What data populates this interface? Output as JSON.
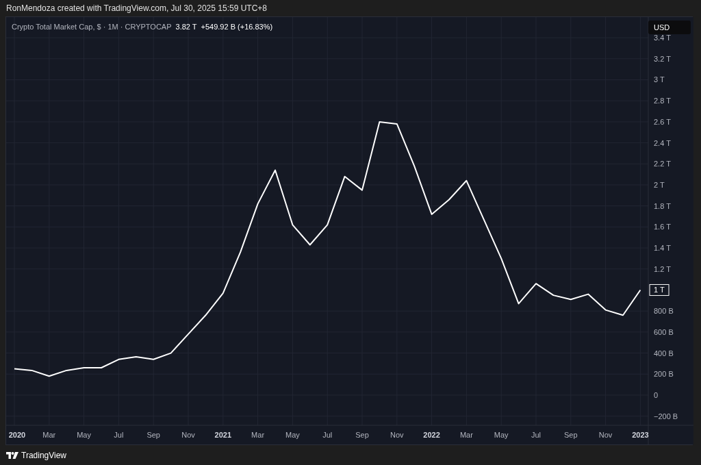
{
  "attribution": "RonMendoza created with TradingView.com, Jul 30, 2025 15:59 UTC+8",
  "legend": {
    "title": "Crypto Total Market Cap, $ · 1M · CRYPTOCAP",
    "value": "3.82 T",
    "change": "+549.92 B (+16.83%)"
  },
  "currency_button": "USD",
  "price_label": "1 T",
  "chart": {
    "chart_data": {
      "type": "line",
      "grid": true,
      "categories": [
        "2020",
        null,
        "Mar",
        null,
        "May",
        null,
        "Jul",
        null,
        "Sep",
        null,
        "Nov",
        null,
        "2021",
        null,
        "Mar",
        null,
        "May",
        null,
        "Jul",
        null,
        "Sep",
        null,
        "Nov",
        null,
        "2022",
        null,
        "Mar",
        null,
        "May",
        null,
        "Jul",
        null,
        "Sep",
        null,
        "Nov",
        null,
        "2023"
      ],
      "series": [
        {
          "color": "#ffffff",
          "values": [
            250000000000,
            235000000000,
            180000000000,
            235000000000,
            260000000000,
            260000000000,
            340000000000,
            365000000000,
            340000000000,
            400000000000,
            580000000000,
            760000000000,
            970000000000,
            1360000000000,
            1820000000000,
            2140000000000,
            1620000000000,
            1430000000000,
            1620000000000,
            2080000000000,
            1950000000000,
            2600000000000,
            2580000000000,
            2180000000000,
            1720000000000,
            1860000000000,
            2040000000000,
            1670000000000,
            1300000000000,
            870000000000,
            1060000000000,
            950000000000,
            910000000000,
            960000000000,
            810000000000,
            760000000000,
            1000000000000
          ]
        }
      ],
      "ylim": [
        -287000000000,
        3596000000000
      ],
      "yticks": [
        {
          "value": -200000000000,
          "label": "−200 B"
        },
        {
          "value": 0,
          "label": "0"
        },
        {
          "value": 200000000000,
          "label": "200 B"
        },
        {
          "value": 400000000000,
          "label": "400 B"
        },
        {
          "value": 600000000000,
          "label": "600 B"
        },
        {
          "value": 800000000000,
          "label": "800 B"
        },
        {
          "value": 1200000000000,
          "label": "1.2 T"
        },
        {
          "value": 1400000000000,
          "label": "1.4 T"
        },
        {
          "value": 1600000000000,
          "label": "1.6 T"
        },
        {
          "value": 1800000000000,
          "label": "1.8 T"
        },
        {
          "value": 2000000000000,
          "label": "2 T"
        },
        {
          "value": 2200000000000,
          "label": "2.2 T"
        },
        {
          "value": 2400000000000,
          "label": "2.4 T"
        },
        {
          "value": 2600000000000,
          "label": "2.6 T"
        },
        {
          "value": 2800000000000,
          "label": "2.8 T"
        },
        {
          "value": 3000000000000,
          "label": "3 T"
        },
        {
          "value": 3200000000000,
          "label": "3.2 T"
        },
        {
          "value": 3400000000000,
          "label": "3.4 T"
        }
      ]
    }
  },
  "footer": {
    "logo_text": "TradingView"
  }
}
